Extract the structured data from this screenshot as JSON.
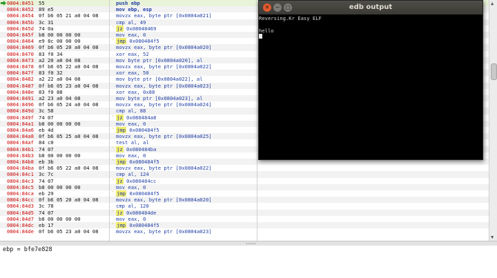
{
  "disassembly": {
    "current_address": "0804:8451",
    "rows": [
      {
        "addr": "0804:8451",
        "bytes": "55",
        "mark": "",
        "ins": "push",
        "ops": "ebp",
        "current": true,
        "jump": false,
        "bold": true
      },
      {
        "addr": "0804:8452",
        "bytes": "89 e5",
        "mark": "",
        "ins": "mov",
        "ops": "ebp, esp",
        "current": false,
        "jump": false,
        "bold": true
      },
      {
        "addr": "0804:8454",
        "bytes": "0f b6 05 21 a0 04 08",
        "mark": "",
        "ins": "movzx",
        "ops": "eax, byte ptr [0x0804a021]",
        "current": false,
        "jump": false,
        "bold": false
      },
      {
        "addr": "0804:845b",
        "bytes": "3c 31",
        "mark": "",
        "ins": "cmp",
        "ops": "al, 49",
        "current": false,
        "jump": false,
        "bold": false
      },
      {
        "addr": "0804:845d",
        "bytes": "74 0a",
        "mark": "`",
        "ins": "jz",
        "ops": "0x08048469",
        "current": false,
        "jump": true,
        "bold": false
      },
      {
        "addr": "0804:845f",
        "bytes": "b8 00 00 00 00",
        "mark": "",
        "ins": "mov",
        "ops": "eax, 0",
        "current": false,
        "jump": false,
        "bold": false
      },
      {
        "addr": "0804:8464",
        "bytes": "e9 8c 00 00 00",
        "mark": "`",
        "ins": "jmp",
        "ops": "0x080484f5",
        "current": false,
        "jump": true,
        "bold": false
      },
      {
        "addr": "0804:8469",
        "bytes": "0f b6 05 20 a0 04 08",
        "mark": "",
        "ins": "movzx",
        "ops": "eax, byte ptr [0x0804a020]",
        "current": false,
        "jump": false,
        "bold": false
      },
      {
        "addr": "0804:8470",
        "bytes": "83 f0 34",
        "mark": "",
        "ins": "xor",
        "ops": "eax, 52",
        "current": false,
        "jump": false,
        "bold": false
      },
      {
        "addr": "0804:8473",
        "bytes": "a2 20 a0 04 08",
        "mark": "",
        "ins": "mov",
        "ops": "byte ptr [0x0804a020], al",
        "current": false,
        "jump": false,
        "bold": false
      },
      {
        "addr": "0804:8478",
        "bytes": "0f b6 05 22 a0 04 08",
        "mark": "",
        "ins": "movzx",
        "ops": "eax, byte ptr [0x0804a022]",
        "current": false,
        "jump": false,
        "bold": false
      },
      {
        "addr": "0804:847f",
        "bytes": "83 f0 32",
        "mark": "",
        "ins": "xor",
        "ops": "eax, 50",
        "current": false,
        "jump": false,
        "bold": false
      },
      {
        "addr": "0804:8482",
        "bytes": "a2 22 a0 04 08",
        "mark": "",
        "ins": "mov",
        "ops": "byte ptr [0x0804a022], al",
        "current": false,
        "jump": false,
        "bold": false
      },
      {
        "addr": "0804:8487",
        "bytes": "0f b6 05 23 a0 04 08",
        "mark": "",
        "ins": "movzx",
        "ops": "eax, byte ptr [0x0804a023]",
        "current": false,
        "jump": false,
        "bold": false
      },
      {
        "addr": "0804:848e",
        "bytes": "83 f0 88",
        "mark": "",
        "ins": "xor",
        "ops": "eax, 0x88",
        "current": false,
        "jump": false,
        "bold": false
      },
      {
        "addr": "0804:8491",
        "bytes": "a2 23 a0 04 08",
        "mark": "",
        "ins": "mov",
        "ops": "byte ptr [0x0804a023], al",
        "current": false,
        "jump": false,
        "bold": false
      },
      {
        "addr": "0804:8496",
        "bytes": "0f b6 05 24 a0 04 08",
        "mark": "",
        "ins": "movzx",
        "ops": "eax, byte ptr [0x0804a024]",
        "current": false,
        "jump": false,
        "bold": false
      },
      {
        "addr": "0804:849d",
        "bytes": "3c 58",
        "mark": "",
        "ins": "cmp",
        "ops": "al, 88",
        "current": false,
        "jump": false,
        "bold": false
      },
      {
        "addr": "0804:849f",
        "bytes": "74 07",
        "mark": "`",
        "ins": "jz",
        "ops": "0x080484a8",
        "current": false,
        "jump": true,
        "bold": false
      },
      {
        "addr": "0804:84a1",
        "bytes": "b8 00 00 00 00",
        "mark": "",
        "ins": "mov",
        "ops": "eax, 0",
        "current": false,
        "jump": false,
        "bold": false
      },
      {
        "addr": "0804:84a6",
        "bytes": "eb 4d",
        "mark": "`",
        "ins": "jmp",
        "ops": "0x080484f5",
        "current": false,
        "jump": true,
        "bold": false
      },
      {
        "addr": "0804:84a8",
        "bytes": "0f b6 05 25 a0 04 08",
        "mark": "",
        "ins": "movzx",
        "ops": "eax, byte ptr [0x0804a025]",
        "current": false,
        "jump": false,
        "bold": false
      },
      {
        "addr": "0804:84af",
        "bytes": "84 c0",
        "mark": "",
        "ins": "test",
        "ops": "al, al",
        "current": false,
        "jump": false,
        "bold": false
      },
      {
        "addr": "0804:84b1",
        "bytes": "74 07",
        "mark": "`",
        "ins": "jz",
        "ops": "0x080484ba",
        "current": false,
        "jump": true,
        "bold": false
      },
      {
        "addr": "0804:84b3",
        "bytes": "b8 00 00 00 00",
        "mark": "",
        "ins": "mov",
        "ops": "eax, 0",
        "current": false,
        "jump": false,
        "bold": false
      },
      {
        "addr": "0804:84b8",
        "bytes": "eb 3b",
        "mark": "`",
        "ins": "jmp",
        "ops": "0x080484f5",
        "current": false,
        "jump": true,
        "bold": false
      },
      {
        "addr": "0804:84ba",
        "bytes": "0f b6 05 22 a0 04 08",
        "mark": "",
        "ins": "movzx",
        "ops": "eax, byte ptr [0x0804a022]",
        "current": false,
        "jump": false,
        "bold": false
      },
      {
        "addr": "0804:84c1",
        "bytes": "3c 7c",
        "mark": "",
        "ins": "cmp",
        "ops": "al, 124",
        "current": false,
        "jump": false,
        "bold": false
      },
      {
        "addr": "0804:84c3",
        "bytes": "74 07",
        "mark": "`",
        "ins": "jz",
        "ops": "0x080484cc",
        "current": false,
        "jump": true,
        "bold": false
      },
      {
        "addr": "0804:84c5",
        "bytes": "b8 00 00 00 00",
        "mark": "",
        "ins": "mov",
        "ops": "eax, 0",
        "current": false,
        "jump": false,
        "bold": false
      },
      {
        "addr": "0804:84ca",
        "bytes": "eb 29",
        "mark": "`",
        "ins": "jmp",
        "ops": "0x080484f5",
        "current": false,
        "jump": true,
        "bold": false
      },
      {
        "addr": "0804:84cc",
        "bytes": "0f b6 05 20 a0 04 08",
        "mark": "",
        "ins": "movzx",
        "ops": "eax, byte ptr [0x0804a020]",
        "current": false,
        "jump": false,
        "bold": false
      },
      {
        "addr": "0804:84d3",
        "bytes": "3c 78",
        "mark": "",
        "ins": "cmp",
        "ops": "al, 120",
        "current": false,
        "jump": false,
        "bold": false
      },
      {
        "addr": "0804:84d5",
        "bytes": "74 07",
        "mark": "`",
        "ins": "jz",
        "ops": "0x080484de",
        "current": false,
        "jump": true,
        "bold": false
      },
      {
        "addr": "0804:84d7",
        "bytes": "b8 00 00 00 00",
        "mark": "",
        "ins": "mov",
        "ops": "eax, 0",
        "current": false,
        "jump": false,
        "bold": false
      },
      {
        "addr": "0804:84dc",
        "bytes": "eb 17",
        "mark": "`",
        "ins": "jmp",
        "ops": "0x080484f5",
        "current": false,
        "jump": true,
        "bold": false
      },
      {
        "addr": "0804:84de",
        "bytes": "0f b6 05 23 a0 04 08",
        "mark": "",
        "ins": "movzx",
        "ops": "eax, byte ptr [0x0804a023]",
        "current": false,
        "jump": false,
        "bold": false
      }
    ]
  },
  "register_pane": {
    "text": "ebp = bfe7e828"
  },
  "output_window": {
    "title": "edb output",
    "lines": [
      "Reversing.Kr Easy ELF",
      "hello"
    ]
  },
  "icons": {
    "current_instruction": "green-arrow-icon",
    "close": "close-icon",
    "minimize": "minimize-icon",
    "maximize": "maximize-icon"
  },
  "colors": {
    "address": "#cc0000",
    "mnemonic": "#1f3ea6",
    "jump_highlight": "#f2ec6a",
    "current_row": "#e8f3d8",
    "close_button": "#e25a2f",
    "terminal_bg": "#000000",
    "terminal_text": "#d8d8d8"
  }
}
